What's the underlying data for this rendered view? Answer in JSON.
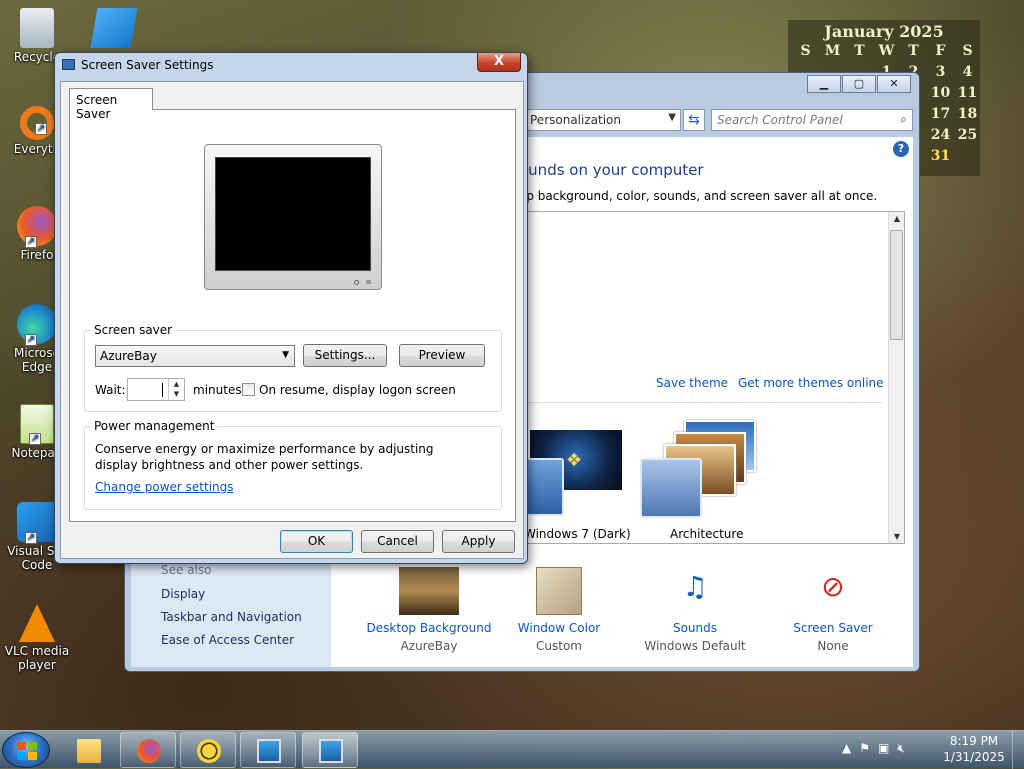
{
  "desktop": {
    "icons": [
      {
        "label": "Recycle",
        "color": "#c9d4dc"
      },
      {
        "label": "Everyth",
        "color": "#f07a1a"
      },
      {
        "label": "Firefo",
        "color": "#e8582a"
      },
      {
        "label": "Microso Edge",
        "color": "#1e88c8"
      },
      {
        "label": "Notepad",
        "color": "#8bc34a"
      },
      {
        "label": "Visual Stu Code",
        "color": "#1f7fd4"
      },
      {
        "label": "VLC media player",
        "color": "#f28a00"
      }
    ]
  },
  "calendar": {
    "month": "January 2025",
    "weekdays": [
      "S",
      "M",
      "T",
      "W",
      "T",
      "F",
      "S"
    ],
    "visible_days": [
      "1",
      "2",
      "3",
      "4",
      "10",
      "11",
      "17",
      "18",
      "24",
      "25",
      "31"
    ]
  },
  "control_panel": {
    "address": "Personalization",
    "search_placeholder": "Search Control Panel",
    "heading": "ounds on your computer",
    "subtext": "op background, color, sounds, and screen saver all at once.",
    "save_theme": "Save theme",
    "more_themes": "Get more themes online",
    "themes": [
      "Windows 7 (Dark)",
      "Architecture"
    ],
    "see_also": "See also",
    "left_links": [
      "Display",
      "Taskbar and Navigation",
      "Ease of Access Center"
    ],
    "bottom": [
      {
        "title": "Desktop Background",
        "sub": "AzureBay"
      },
      {
        "title": "Window Color",
        "sub": "Custom"
      },
      {
        "title": "Sounds",
        "sub": "Windows Default"
      },
      {
        "title": "Screen Saver",
        "sub": "None"
      }
    ]
  },
  "dialog": {
    "title": "Screen Saver Settings",
    "close": "X",
    "tab": "Screen Saver",
    "screensaver_group": "Screen saver",
    "selected_saver": "AzureBay",
    "settings_btn": "Settings...",
    "preview_btn": "Preview",
    "wait_label": "Wait:",
    "wait_value": "",
    "minutes_label": "minutes",
    "resume_label": "On resume, display logon screen",
    "resume_checked": false,
    "power_group": "Power management",
    "power_text": "Conserve energy or maximize performance by adjusting display brightness and other power settings.",
    "power_link": "Change power settings",
    "ok": "OK",
    "cancel": "Cancel",
    "apply": "Apply"
  },
  "taskbar": {
    "clock_time": "8:19 PM",
    "clock_date": "1/31/2025"
  }
}
